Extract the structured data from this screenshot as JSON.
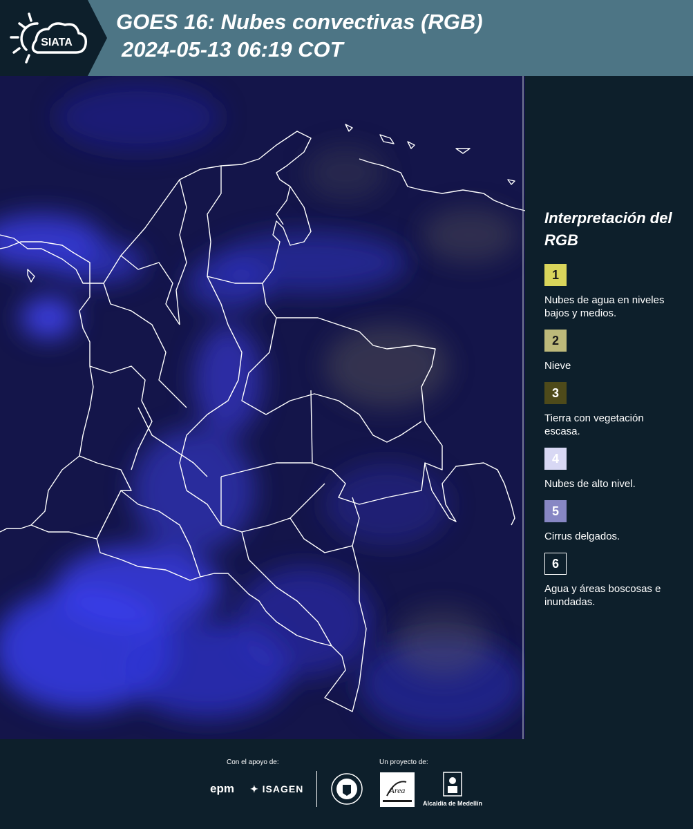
{
  "header": {
    "logo_text": "SIATA",
    "title_line1": "GOES 16: Nubes convectivas (RGB)",
    "title_line2": "2024-05-13 06:19 COT",
    "colors": {
      "dark": "#0d1f2b",
      "band": "#4d7585"
    }
  },
  "map": {
    "icon": "satellite-map-colombia",
    "colors": {
      "base": "#14154a",
      "clouds": "#3a3fe0",
      "borders": "#ffffff"
    }
  },
  "legend": {
    "title": "Interpretación del RGB",
    "items": [
      {
        "number": "1",
        "label": "Nubes de agua en niveles bajos y medios.",
        "color": "#d9d55b"
      },
      {
        "number": "2",
        "label": "Nieve",
        "color": "#bdb97a"
      },
      {
        "number": "3",
        "label": "Tierra con vegetación escasa.",
        "color": "#4e4a1a"
      },
      {
        "number": "4",
        "label": "Nubes de alto nivel.",
        "color": "#d8d8f4"
      },
      {
        "number": "5",
        "label": "Cirrus delgados.",
        "color": "#8787c4"
      },
      {
        "number": "6",
        "label": "Agua y áreas boscosas e inundadas.",
        "color": "#0d1f2b"
      }
    ]
  },
  "footer": {
    "support_label": "Con el apoyo de:",
    "project_label": "Un proyecto de:",
    "sponsors": [
      "epm",
      "ISAGEN"
    ],
    "partner_logos": [
      "medellin-seal",
      "area-metropolitana-logo",
      "alcaldia-de-medellin-logo"
    ],
    "alcaldia_text": "Alcaldía de Medellín"
  }
}
